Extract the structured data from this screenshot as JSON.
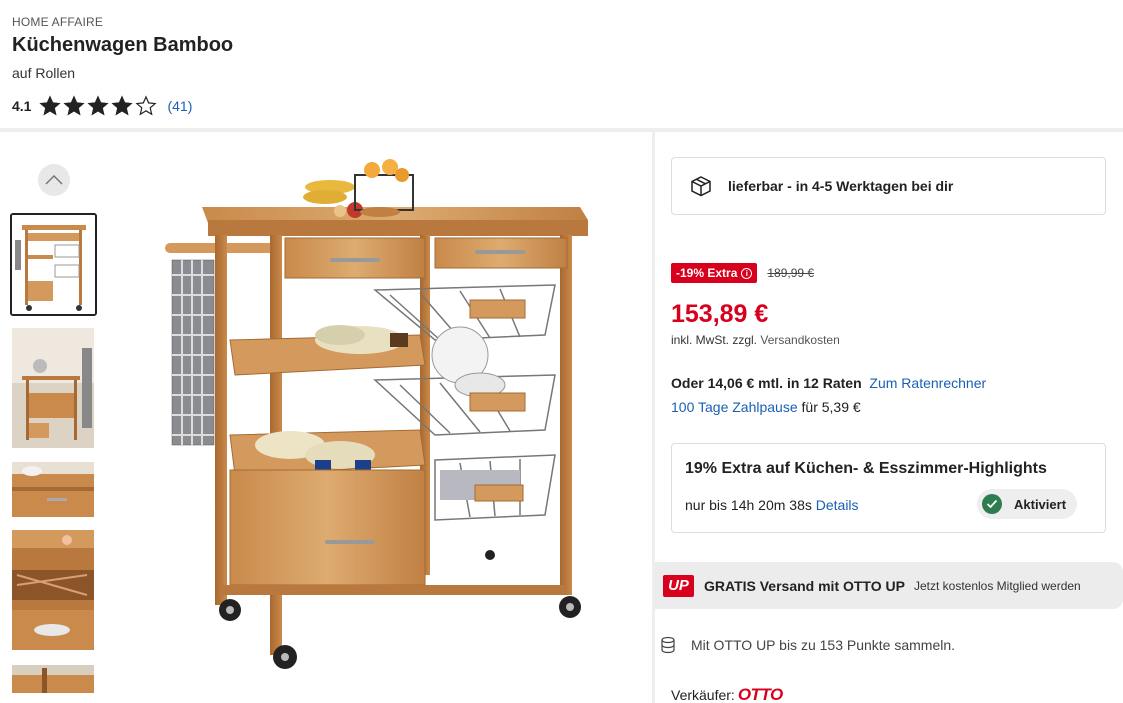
{
  "product": {
    "brand": "HOME AFFAIRE",
    "title": "Küchenwagen Bamboo",
    "subtitle": "auf Rollen",
    "rating_value": "4.1",
    "rating_stars": 4,
    "rating_max": 5,
    "rating_count": "(41)"
  },
  "gallery": {
    "thumbnails": [
      "thumb-1",
      "thumb-2",
      "thumb-3",
      "thumb-4",
      "thumb-5"
    ],
    "active_index": 0
  },
  "delivery": {
    "icon": "package-icon",
    "text": "lieferbar - in 4-5 Werktagen bei dir"
  },
  "pricing": {
    "badge": "-19% Extra",
    "old_price": "189,99 €",
    "price": "153,89 €",
    "note_prefix": "inkl. MwSt. zzgl.",
    "note_link": "Versandkosten",
    "installment": "Oder 14,06 € mtl. in 12 Raten",
    "installment_link": "Zum Ratenrechner",
    "pause_link": "100 Tage Zahlpause",
    "pause_suffix": "für 5,39 €"
  },
  "promo": {
    "title": "19% Extra auf Küchen- & Esszimmer-Highlights",
    "countdown": "nur bis 14h 20m 38s",
    "details_link": "Details",
    "status": "Aktiviert"
  },
  "otto_up": {
    "logo": "UP",
    "title": "GRATIS Versand mit OTTO UP",
    "subtitle": "Jetzt kostenlos Mitglied werden",
    "points": "Mit OTTO UP bis zu 153 Punkte sammeln."
  },
  "seller": {
    "label": "Verkäufer:",
    "name": "OTTO"
  },
  "colors": {
    "accent_red": "#d8001c",
    "link_blue": "#1a5fb4",
    "success_green": "#2e7d4f"
  }
}
